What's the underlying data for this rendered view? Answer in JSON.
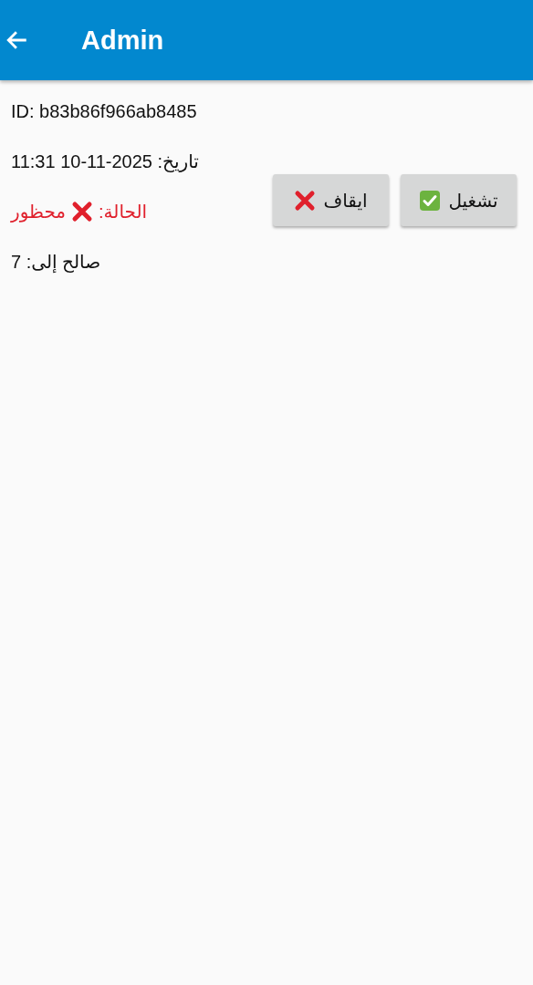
{
  "app_bar": {
    "title": "Admin"
  },
  "info": {
    "id": "ID: b83b86f966ab8485",
    "date": "تاريخ: 2025-11-10 11:31",
    "status": {
      "label": "الحالة:",
      "value": "محظور",
      "kind": "banned"
    },
    "valid": "صالح إلى: 7"
  },
  "buttons": [
    {
      "label": "تشغيل",
      "kind": "start"
    },
    {
      "label": "ايقاف",
      "kind": "stop"
    }
  ]
}
